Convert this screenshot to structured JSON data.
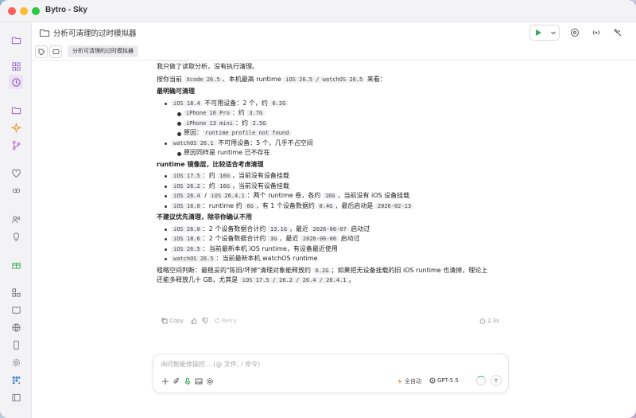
{
  "window": {
    "title": "Bytro - Sky"
  },
  "topbar": {
    "title": "分析可清理的过时模拟器"
  },
  "tabbar": {
    "active_tab": "分析可清理的过时模拟器"
  },
  "message": {
    "intro": "我只做了读取分析，没有执行清理。",
    "lead_a": "按你当前",
    "lead_code1": "Xcode 26.5",
    "lead_b": "、本机最高 runtime",
    "lead_code2": "iOS 26.5 / watchOS 26.5",
    "lead_c": "来看：",
    "sec1_heading": "最明确可清理",
    "s1_i1_code": "iOS 18.4",
    "s1_i1_text": "不可用设备：2 个，约",
    "s1_i1_size": "6.2G",
    "s1_i1_sub1_code": "iPhone 16 Pro",
    "s1_i1_sub1_text": "：约",
    "s1_i1_sub1_size": "3.7G",
    "s1_i1_sub2_code": "iPhone 13 mini",
    "s1_i1_sub2_text": "：约",
    "s1_i1_sub2_size": "2.5G",
    "s1_i1_sub3_text": "原因：",
    "s1_i1_sub3_code": "runtime profile not found",
    "s1_i2_code": "watchOS 26.1",
    "s1_i2_text": "不可用设备：5 个，几乎不占空间",
    "s1_i2_sub1_text": "原因同样是 runtime 已不存在",
    "sec2_heading": "runtime 镜像层，比较适合考虑清理",
    "s2_i1_code": "iOS 17.5",
    "s2_i1_text": "：约",
    "s2_i1_size": "16G",
    "s2_i1_tail": "，当前没有设备挂载",
    "s2_i2_code": "iOS 26.2",
    "s2_i2_text": "：约",
    "s2_i2_size": "16G",
    "s2_i2_tail": "，当前没有设备挂载",
    "s2_i3_code1": "iOS 26.4",
    "s2_i3_sep": "/",
    "s2_i3_code2": "iOS 26.4.1",
    "s2_i3_text": "：两个 runtime 卷，各约",
    "s2_i3_size": "16G",
    "s2_i3_tail": "，当前没有 iOS 设备挂载",
    "s2_i4_code": "iOS 16.0",
    "s2_i4_text": "：runtime 约",
    "s2_i4_size": "6G",
    "s2_i4_mid": "，有 1 个设备数据约",
    "s2_i4_size2": "0.4G",
    "s2_i4_mid2": "，最后启动是",
    "s2_i4_date": "2026-02-13",
    "sec3_heading": "不建议优先清理，除非你确认不用",
    "s3_i1_code": "iOS 26.0",
    "s3_i1_text": "：2 个设备数据合计约",
    "s3_i1_size": "13.1G",
    "s3_i1_mid": "，最近",
    "s3_i1_date": "2026-06-07",
    "s3_i1_tail": "启动过",
    "s3_i2_code": "iOS 18.6",
    "s3_i2_text": "：2 个设备数据合计约",
    "s3_i2_size": "3G",
    "s3_i2_mid": "，最近",
    "s3_i2_date": "2026-06-06",
    "s3_i2_tail": "启动过",
    "s3_i3_code": "iOS 26.5",
    "s3_i3_text": "：当前最新本机 iOS runtime，有设备最近使用",
    "s3_i4_code": "watchOS 26.5",
    "s3_i4_text": "：当前最新本机 watchOS runtime",
    "summary_a": "粗略空间判断：最稳妥的\"陈旧/坏掉\"清理对象能释放约",
    "summary_code": "6.2G",
    "summary_b": "；如果把无设备挂载的旧 iOS runtime 也清掉，理论上",
    "summary_c": "还能多释放几十 GB，尤其是",
    "summary_code2": "iOS 17.5 / 26.2 / 26.4 / 26.4.1",
    "summary_d": "。"
  },
  "actions": {
    "copy": "Copy",
    "retry": "Retry",
    "duration": "2.3s"
  },
  "composer": {
    "placeholder": "询问智能体操控... (@ 文件, / 命令)",
    "mode": "全自动",
    "model": "GPT-5.5"
  },
  "colors": {
    "accent_green": "#3aa856",
    "active_purple": "#8e5cc4",
    "folder_purple": "#9a6fd0"
  }
}
